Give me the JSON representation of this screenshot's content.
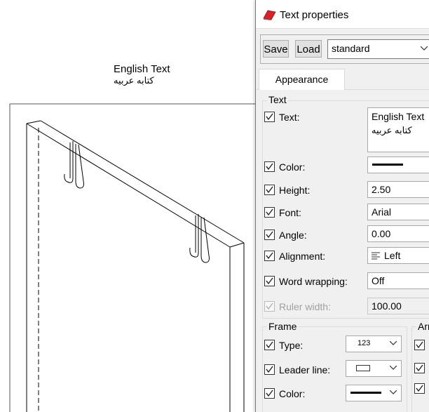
{
  "canvas": {
    "text_line1": "English Text",
    "text_line2": "كتابه عربيه"
  },
  "dialog": {
    "title": "Text properties",
    "icon": "pencil-app-icon",
    "save_label": "Save",
    "load_label": "Load",
    "preset_value": "standard",
    "tab_appearance": "Appearance"
  },
  "text_group": {
    "label": "Text",
    "fields": {
      "text": {
        "label": "Text:",
        "line1": "English Text",
        "line2": "كتابه عربيه"
      },
      "color": {
        "label": "Color:",
        "value_color": "#000000"
      },
      "height": {
        "label": "Height:",
        "value": "2.50"
      },
      "font": {
        "label": "Font:",
        "value": "Arial"
      },
      "angle": {
        "label": "Angle:",
        "value": "0.00"
      },
      "alignment": {
        "label": "Alignment:",
        "value": "Left"
      },
      "word_wrapping": {
        "label": "Word wrapping:",
        "value": "Off"
      },
      "ruler_width": {
        "label": "Ruler width:",
        "value": "100.00"
      }
    }
  },
  "frame_group": {
    "label": "Frame",
    "type": {
      "label": "Type:",
      "value": "123"
    },
    "leader_line": {
      "label": "Leader line:"
    },
    "color": {
      "label": "Color:"
    }
  },
  "arrow_group": {
    "label": "Arr"
  }
}
